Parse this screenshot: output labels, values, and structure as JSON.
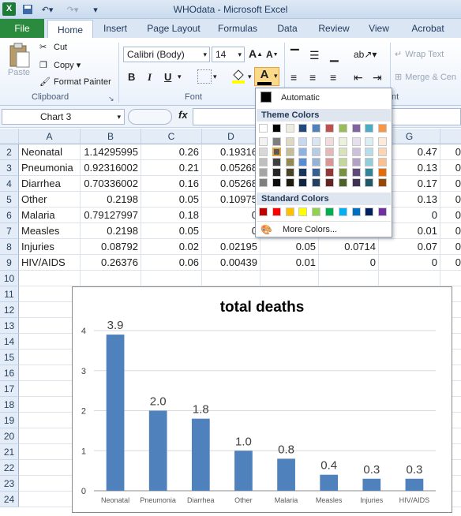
{
  "window": {
    "title": "WHOdata  -  Microsoft Excel",
    "app_logo": "X"
  },
  "tabs": {
    "file": "File",
    "items": [
      "Home",
      "Insert",
      "Page Layout",
      "Formulas",
      "Data",
      "Review",
      "View",
      "Acrobat"
    ],
    "active": "Home"
  },
  "ribbon": {
    "clipboard": {
      "paste": "Paste",
      "cut": "Cut",
      "copy": "Copy",
      "format_painter": "Format Painter",
      "label": "Clipboard"
    },
    "font": {
      "family": "Calibri (Body)",
      "size": "14",
      "bold": "B",
      "italic": "I",
      "underline": "U",
      "label": "Font"
    },
    "alignment": {
      "wrap": "Wrap Text",
      "merge": "Merge & Cen"
    }
  },
  "formula_bar": {
    "name_box": "Chart 3",
    "fx": "fx",
    "value": ""
  },
  "grid": {
    "columns": [
      "A",
      "B",
      "C",
      "D",
      "E",
      "F",
      "G"
    ],
    "row_numbers": [
      "2",
      "3",
      "4",
      "5",
      "6",
      "7",
      "8",
      "9",
      "10",
      "11",
      "12",
      "13",
      "14",
      "15",
      "16",
      "17",
      "18",
      "19",
      "20",
      "21",
      "22",
      "23",
      "24"
    ],
    "rows": [
      [
        "Neonatal",
        "1.14295995",
        "0.26",
        "0.19316",
        "",
        "",
        "0.47"
      ],
      [
        "Pneumonia",
        "0.92316002",
        "0.21",
        "0.05268",
        "",
        "",
        "0.13"
      ],
      [
        "Diarrhea",
        "0.70336002",
        "0.16",
        "0.05268",
        "",
        "",
        "0.17"
      ],
      [
        "Other",
        "0.2198",
        "0.05",
        "0.10975",
        "",
        "",
        "0.13"
      ],
      [
        "Malaria",
        "0.79127997",
        "0.18",
        "0",
        "",
        "",
        "0"
      ],
      [
        "Measles",
        "0.2198",
        "0.05",
        "0",
        "",
        "",
        "0.01"
      ],
      [
        "Injuries",
        "0.08792",
        "0.02",
        "0.02195",
        "0.05",
        "0.0714",
        "0.07"
      ],
      [
        "HIV/AIDS",
        "0.26376",
        "0.06",
        "0.00439",
        "0.01",
        "0",
        "0"
      ]
    ],
    "extra_col": [
      "0",
      "0",
      "0",
      "0",
      "0",
      "0",
      "0",
      "0"
    ]
  },
  "font_color_menu": {
    "automatic": "Automatic",
    "theme_header": "Theme Colors",
    "standard_header": "Standard Colors",
    "more": "More Colors...",
    "theme_top": [
      "#ffffff",
      "#000000",
      "#eeece1",
      "#1f497d",
      "#4f81bd",
      "#c0504d",
      "#9bbb59",
      "#8064a2",
      "#4bacc6",
      "#f79646"
    ],
    "theme_shades": [
      [
        "#f2f2f2",
        "#7f7f7f",
        "#ddd9c3",
        "#c6d9f0",
        "#dbe5f1",
        "#f2dcdb",
        "#ebf1dd",
        "#e5e0ec",
        "#dbeef3",
        "#fdeada"
      ],
      [
        "#d8d8d8",
        "#595959",
        "#c4bd97",
        "#8db3e2",
        "#b8cce4",
        "#e5b9b7",
        "#d7e3bc",
        "#ccc1d9",
        "#b7dde8",
        "#fbd5b5"
      ],
      [
        "#bfbfbf",
        "#3f3f3f",
        "#938953",
        "#548dd4",
        "#95b3d7",
        "#d99694",
        "#c3d69b",
        "#b2a2c7",
        "#92cddc",
        "#fac08f"
      ],
      [
        "#a5a5a5",
        "#262626",
        "#494429",
        "#17365d",
        "#366092",
        "#953734",
        "#76923c",
        "#5f497a",
        "#31859b",
        "#e36c09"
      ],
      [
        "#7f7f7f",
        "#0c0c0c",
        "#1d1b10",
        "#0f243e",
        "#244061",
        "#632423",
        "#4f6128",
        "#3f3151",
        "#205867",
        "#974806"
      ]
    ],
    "standard": [
      "#c00000",
      "#ff0000",
      "#ffc000",
      "#ffff00",
      "#92d050",
      "#00b050",
      "#00b0f0",
      "#0070c0",
      "#002060",
      "#7030a0"
    ]
  },
  "chart_data": {
    "type": "bar",
    "title": "total deaths",
    "categories": [
      "Neonatal",
      "Pneumonia",
      "Diarrhea",
      "Other",
      "Malaria",
      "Measles",
      "Injuries",
      "HIV/AIDS"
    ],
    "values": [
      3.9,
      2.0,
      1.8,
      1.0,
      0.8,
      0.4,
      0.3,
      0.3
    ],
    "data_labels": [
      "3.9",
      "2.0",
      "1.8",
      "1.0",
      "0.8",
      "0.4",
      "0.3",
      "0.3"
    ],
    "yticks": [
      "0",
      "1",
      "2",
      "3",
      "4"
    ],
    "ylim": [
      0,
      4
    ],
    "grid": true,
    "bar_color": "#4f81bd"
  }
}
